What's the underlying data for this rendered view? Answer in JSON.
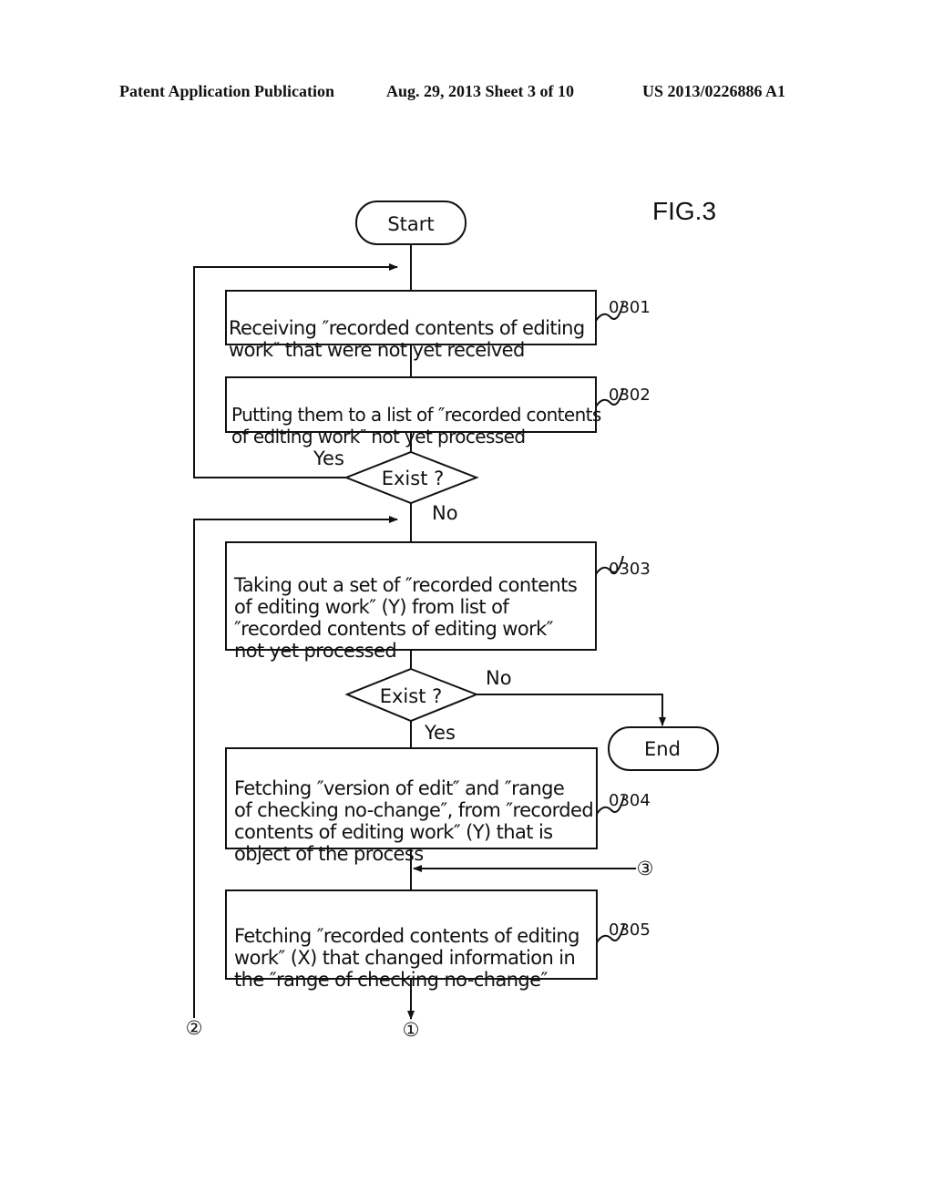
{
  "header": {
    "publication": "Patent Application Publication",
    "date_sheet": "Aug. 29, 2013  Sheet 3 of 10",
    "number": "US 2013/0226886 A1"
  },
  "figure_label": "FIG.3",
  "nodes": {
    "start": "Start",
    "end": "End",
    "step_0301": {
      "ref": "0301",
      "lines": [
        "Receiving ″recorded contents of editing",
        "work″ that were not yet received"
      ]
    },
    "step_0302": {
      "ref": "0302",
      "lines": [
        "Putting them to a list of ″recorded contents",
        "of editing work″ not yet processed"
      ]
    },
    "decision_1": "Exist ?",
    "step_0303": {
      "ref": "0303",
      "lines": [
        "Taking out a set of ″recorded contents",
        "of editing work″ (Y) from list of",
        "″recorded contents of editing work″",
        "not yet processed"
      ]
    },
    "decision_2": "Exist ?",
    "step_0304": {
      "ref": "0304",
      "lines": [
        "Fetching ″version of edit″ and ″range",
        "of checking no-change″, from ″recorded",
        "contents of editing work″ (Y) that is",
        "object of the process"
      ]
    },
    "step_0305": {
      "ref": "0305",
      "lines": [
        "Fetching ″recorded contents of editing",
        "work″ (X) that changed information in",
        "the ″range of checking no-change″"
      ]
    }
  },
  "edge_labels": {
    "d1_yes": "Yes",
    "d1_no": "No",
    "d2_no": "No",
    "d2_yes": "Yes"
  },
  "connectors": {
    "c1": "①",
    "c2": "②",
    "c3": "③"
  }
}
